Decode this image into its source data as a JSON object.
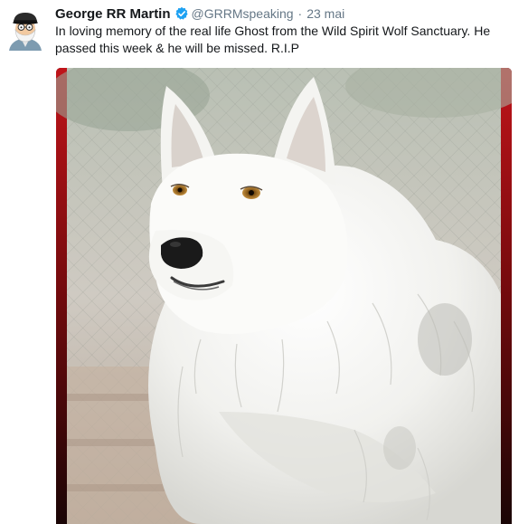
{
  "tweet": {
    "author": {
      "display_name": "George RR Martin",
      "handle": "@GRRMspeaking",
      "verified": true,
      "avatar_icon": "cartoon-portrait-avatar"
    },
    "separator": "·",
    "timestamp": "23 mai",
    "text_lines": [
      "In loving memory of the real life Ghost from the Wild Spirit Wolf Sanctuary.  He",
      "passed this week & he will be missed. R.I.P"
    ],
    "media": {
      "kind": "photo",
      "subject_icon": "white-wolf-photo"
    }
  },
  "colors": {
    "name": "#14171a",
    "meta": "#657786",
    "verified_badge": "#1da1f2",
    "frame_red": "#c0141a",
    "frame_dark": "#1a0505"
  }
}
